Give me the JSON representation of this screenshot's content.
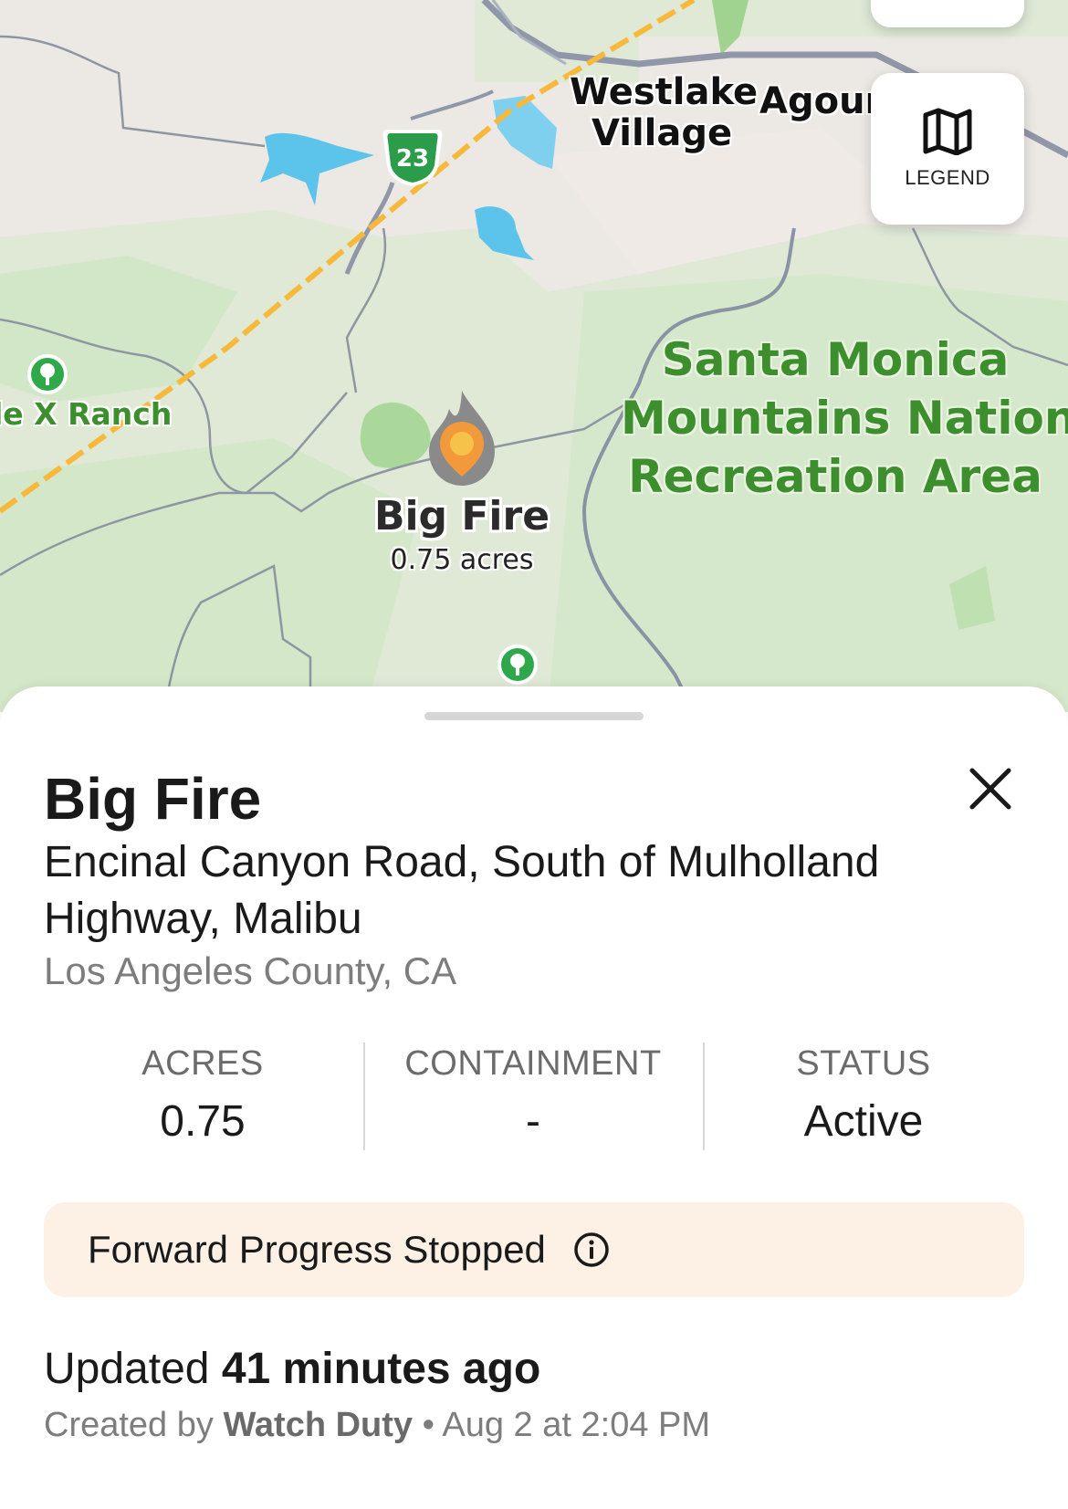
{
  "map": {
    "highway_shield": "23",
    "labels": {
      "westlake_line1": "Westlake",
      "westlake_line2": "Village",
      "agoura": "Agoura",
      "ranch": "le X Ranch",
      "park_line1": "Santa Monica",
      "park_line2": "Mountains National",
      "park_line3": "Recreation Area"
    },
    "fire_marker": {
      "name": "Big Fire",
      "acres_label": "0.75 acres"
    },
    "legend_button": {
      "label": "LEGEND",
      "icon": "map-icon"
    }
  },
  "incident": {
    "title": "Big Fire",
    "address": "Encinal Canyon Road, South of Mulholland Highway, Malibu",
    "county": "Los Angeles County, CA",
    "stats": [
      {
        "label": "ACRES",
        "value": "0.75"
      },
      {
        "label": "CONTAINMENT",
        "value": "-"
      },
      {
        "label": "STATUS",
        "value": "Active"
      }
    ],
    "banner": {
      "text": "Forward Progress Stopped",
      "icon": "info-icon"
    },
    "updated_prefix": "Updated",
    "updated_value": "41 minutes ago",
    "created_prefix": "Created by",
    "created_by": "Watch Duty",
    "created_separator": "•",
    "created_date": "Aug 2 at 2:04 PM"
  },
  "colors": {
    "map_background": "#dfe9d6",
    "park_text": "#3d8f2e",
    "fire_orange": "#f29a3b",
    "banner_background": "#fdf1e6"
  }
}
